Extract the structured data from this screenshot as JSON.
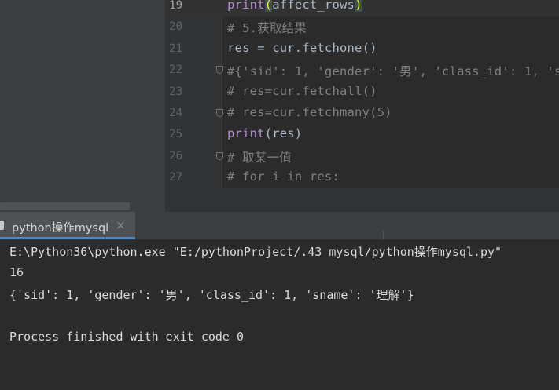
{
  "editor": {
    "lines": [
      {
        "num": "19",
        "parts": [
          {
            "t": "print",
            "c": "kw"
          },
          {
            "t": "(",
            "c": "paren-hl"
          },
          {
            "t": "affect_rows",
            "c": ""
          },
          {
            "t": ")",
            "c": "paren-hl"
          }
        ],
        "current": true,
        "fold": false
      },
      {
        "num": "20",
        "parts": [
          {
            "t": "# 5.获取结果",
            "c": "cm"
          }
        ],
        "current": false,
        "fold": false
      },
      {
        "num": "21",
        "parts": [
          {
            "t": "res = cur.fetchone()",
            "c": ""
          }
        ],
        "current": false,
        "fold": false
      },
      {
        "num": "22",
        "parts": [
          {
            "t": "#{'sid': 1, 'gender': '男', 'class_id': 1, 's",
            "c": "cm"
          }
        ],
        "current": false,
        "fold": true
      },
      {
        "num": "23",
        "parts": [
          {
            "t": "# res=cur.fetchall()",
            "c": "cm"
          }
        ],
        "current": false,
        "fold": false
      },
      {
        "num": "24",
        "parts": [
          {
            "t": "# res=cur.fetchmany(5)",
            "c": "cm"
          }
        ],
        "current": false,
        "fold": true
      },
      {
        "num": "25",
        "parts": [
          {
            "t": "print",
            "c": "kw"
          },
          {
            "t": "(res)",
            "c": ""
          }
        ],
        "current": false,
        "fold": false
      },
      {
        "num": "26",
        "parts": [
          {
            "t": "# 取某一值",
            "c": "cm"
          }
        ],
        "current": false,
        "fold": true
      },
      {
        "num": "27",
        "parts": [
          {
            "t": "# for i in res:",
            "c": "cm"
          }
        ],
        "current": false,
        "fold": false
      }
    ]
  },
  "run_tab": {
    "label": "python操作mysql",
    "close": "×"
  },
  "console": {
    "lines": [
      "E:\\Python36\\python.exe \"E:/pythonProject/.43 mysql/python操作mysql.py\"",
      "16",
      "{'sid': 1, 'gender': '男', 'class_id': 1, 'sname': '理解'}",
      "",
      "Process finished with exit code 0"
    ]
  }
}
